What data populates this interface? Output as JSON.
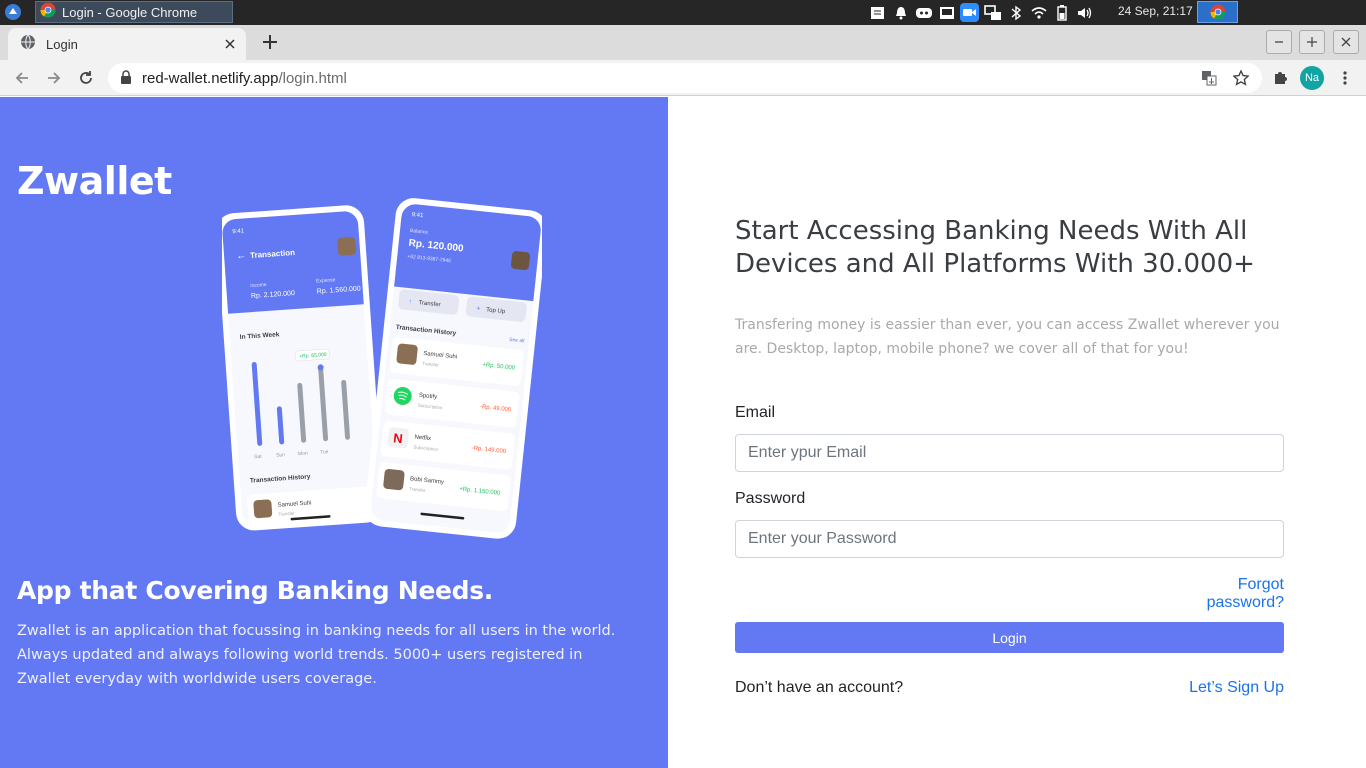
{
  "os": {
    "window_title": "Login - Google Chrome",
    "clock": "24 Sep, 21:17",
    "tray_icons": [
      "notes-icon",
      "bell-icon",
      "discord-icon",
      "inbox-icon",
      "zoom-icon",
      "switch-icon",
      "bluetooth-icon",
      "wifi-icon",
      "battery-icon",
      "volume-icon"
    ]
  },
  "browser": {
    "tab_title": "Login",
    "url_domain": "red-wallet.netlify.app",
    "url_path": "/login.html",
    "profile_initials": "Na"
  },
  "left": {
    "brand": "Zwallet",
    "heading": "App that Covering Banking Needs.",
    "description": "Zwallet is an application that focussing in banking needs for all users in the world. Always updated and always following world trends. 5000+ users registered in Zwallet everyday with worldwide users coverage."
  },
  "mockup": {
    "phone1": {
      "time": "9:41",
      "title": "Transaction",
      "income_label": "Income",
      "income_value": "Rp. 2.120.000",
      "expense_label": "Expense",
      "expense_value": "Rp. 1.560.000",
      "week_label": "In This Week",
      "bubble": "+Rp. 65.000",
      "days": [
        "Sat",
        "Sun",
        "Mon",
        "Tue"
      ],
      "history_label": "Transaction History",
      "history_name": "Samuel Suhi",
      "history_sub": "Transfer"
    },
    "phone2": {
      "time": "9:41",
      "balance_label": "Balance",
      "balance": "Rp. 120.000",
      "phone_number": "+62 813-9387-7946",
      "transfer": "Transfer",
      "topup": "Top Up",
      "history_label": "Transaction History",
      "see_all": "See all",
      "items": [
        {
          "name": "Samuel Suhi",
          "sub": "Transfer",
          "amount": "+Rp. 50.000",
          "positive": true
        },
        {
          "name": "Spotify",
          "sub": "Subscription",
          "amount": "-Rp. 49.000",
          "positive": false
        },
        {
          "name": "Netflix",
          "sub": "Subscription",
          "amount": "-Rp. 149.000",
          "positive": false
        },
        {
          "name": "Bobi Sammy",
          "sub": "Transfer",
          "amount": "+Rp. 1.150.000",
          "positive": true
        }
      ]
    }
  },
  "right": {
    "headline": "Start Accessing Banking Needs With All Devices and All Platforms With 30.000+",
    "subtext": "Transfering money is eassier than ever, you can access Zwallet wherever you are. Desktop, laptop, mobile phone? we cover all of that for you!",
    "email_label": "Email",
    "email_placeholder": "Enter ypur Email",
    "password_label": "Password",
    "password_placeholder": "Enter your Password",
    "forgot": "Forgot password?",
    "login_button": "Login",
    "no_account": "Don’t have an account?",
    "signup": "Let’s Sign Up"
  },
  "colors": {
    "primary": "#6379f4",
    "link": "#1a73e8",
    "income": "#1ec15f",
    "expense": "#ff5b37"
  }
}
